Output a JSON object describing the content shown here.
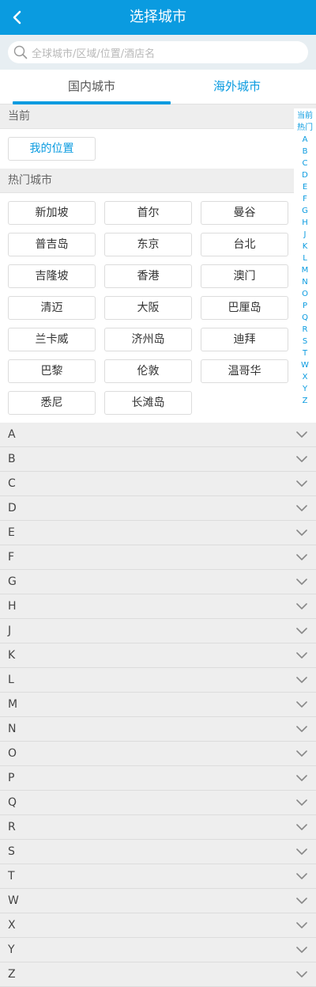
{
  "header": {
    "title": "选择城市",
    "back_icon": "chevron-left-icon"
  },
  "search": {
    "placeholder": "全球城市/区域/位置/酒店名",
    "icon": "search-icon"
  },
  "tabs": [
    {
      "label": "国内城市",
      "selected": true
    },
    {
      "label": "海外城市",
      "selected": false
    }
  ],
  "current": {
    "section_title": "当前",
    "my_location": "我的位置"
  },
  "hot": {
    "section_title": "热门城市",
    "cities": [
      "新加坡",
      "首尔",
      "曼谷",
      "普吉岛",
      "东京",
      "台北",
      "吉隆坡",
      "香港",
      "澳门",
      "清迈",
      "大阪",
      "巴厘岛",
      "兰卡威",
      "济州岛",
      "迪拜",
      "巴黎",
      "伦敦",
      "温哥华",
      "悉尼",
      "长滩岛"
    ]
  },
  "alphabet_sections": [
    "A",
    "B",
    "C",
    "D",
    "E",
    "F",
    "G",
    "H",
    "J",
    "K",
    "L",
    "M",
    "N",
    "O",
    "P",
    "Q",
    "R",
    "S",
    "T",
    "W",
    "X",
    "Y",
    "Z"
  ],
  "index_bar": [
    "当前",
    "热门",
    "A",
    "B",
    "C",
    "D",
    "E",
    "F",
    "G",
    "H",
    "J",
    "K",
    "L",
    "M",
    "N",
    "O",
    "P",
    "Q",
    "R",
    "S",
    "T",
    "W",
    "X",
    "Y",
    "Z"
  ],
  "colors": {
    "accent": "#0a9be0",
    "background": "#eeeeee"
  }
}
